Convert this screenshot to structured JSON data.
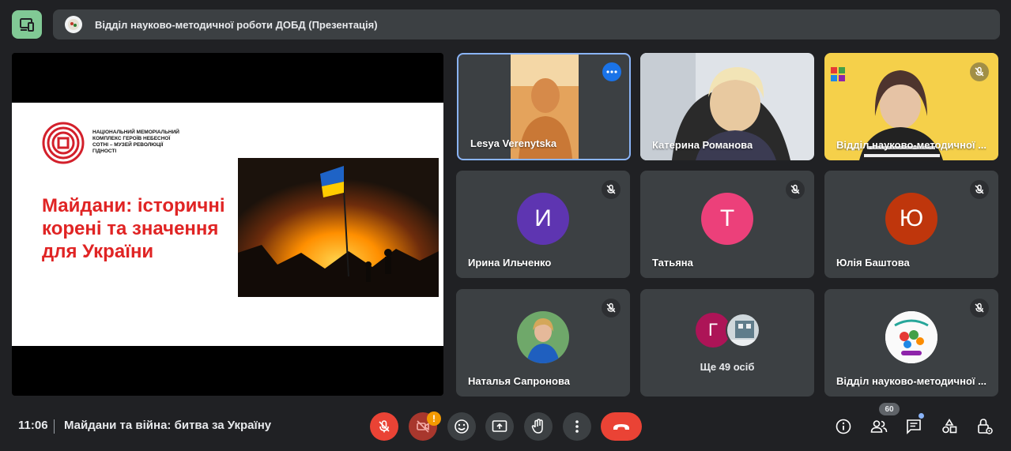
{
  "header": {
    "title": "Відділ науково-методичної роботи ДОБД (Презентація)",
    "layout_icon": "companion-mode-icon"
  },
  "presentation": {
    "logo_text": "НАЦІОНАЛЬНИЙ МЕМОРІАЛЬНИЙ КОМПЛЕКС ГЕРОЇВ НЕБЕСНОЇ СОТНІ – МУЗЕЙ РЕВОЛЮЦІЇ ГІДНОСТІ",
    "slide_title": "Майдани: історичні корені та значення для України",
    "title_color": "#e02424"
  },
  "participants": [
    {
      "name": "Lesya Verenytska",
      "type": "video",
      "active_speaker": true,
      "has_menu": true
    },
    {
      "name": "Катерина Романова",
      "type": "video"
    },
    {
      "name": "Відділ науково-методичної ...",
      "type": "video",
      "muted": true
    },
    {
      "name": "Ирина Ильченко",
      "letter": "И",
      "color": "#5e35b1",
      "muted": true
    },
    {
      "name": "Татьяна",
      "letter": "Т",
      "color": "#ec407a",
      "muted": true
    },
    {
      "name": "Юлія Баштова",
      "letter": "Ю",
      "color": "#bf360c",
      "muted": true
    },
    {
      "name": "Наталья Сапронова",
      "type": "photo-avatar",
      "muted": true
    },
    {
      "name": "Ще 49 осіб",
      "type": "others",
      "letter": "Г",
      "color": "#ad1457"
    },
    {
      "name": "Відділ науково-методичної ...",
      "type": "logo-avatar",
      "muted": true
    }
  ],
  "footer": {
    "time": "11:06",
    "meeting_title": "Майдани та війна: битва за Україну",
    "participants_count": "60",
    "camera_warning": "!"
  },
  "controls": [
    "mic-off-icon",
    "camera-off-icon",
    "emoji-icon",
    "present-icon",
    "raise-hand-icon",
    "more-options-icon",
    "end-call-icon"
  ],
  "right_controls": [
    "info-icon",
    "people-icon",
    "chat-icon",
    "activities-icon",
    "host-controls-icon"
  ]
}
